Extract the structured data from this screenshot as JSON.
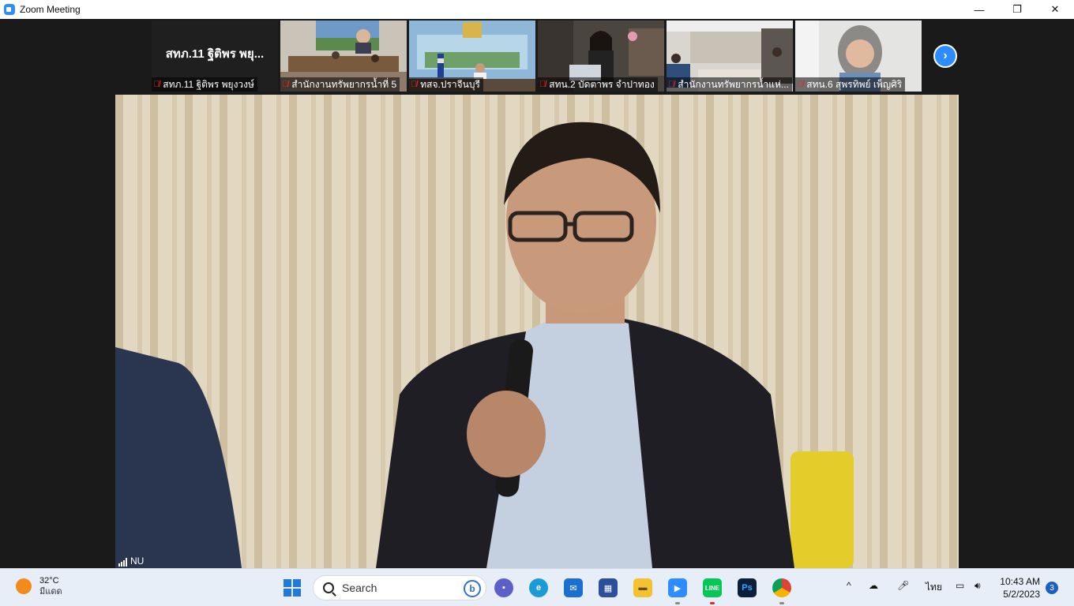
{
  "window": {
    "title": "Zoom Meeting",
    "controls": {
      "minimize": "—",
      "restore": "❐",
      "close": "✕"
    }
  },
  "gallery": {
    "tiles": [
      {
        "big_name": "สทภ.11 ฐิติพร พยุ...",
        "label": "สทภ.11 ฐิติพร พยุงวงษ์"
      },
      {
        "label": "สำนักงานทรัพยากรน้ำที่ 5"
      },
      {
        "label": "ทสจ.ปราจีนบุรี"
      },
      {
        "label": "สทน.2 บัดตาพร จำปาทอง"
      },
      {
        "label": "สำนักงานทรัพยากรน้ำแห่..."
      },
      {
        "label": "สทน.6 สุพรทิพย์ เพ็ญศิริ"
      }
    ],
    "mute_icon": "muted-mic-icon",
    "next_icon": "›"
  },
  "main_video": {
    "network_label": "NU"
  },
  "taskbar": {
    "weather": {
      "temp": "32°C",
      "condition": "มีแดด"
    },
    "search_label": "Search",
    "bing_label": "b",
    "apps": {
      "line_label": "LINE",
      "ps_label": "Ps"
    },
    "tray": {
      "chevron": "^",
      "language": "ไทย"
    },
    "clock": {
      "time": "10:43 AM",
      "date": "5/2/2023"
    },
    "notification_count": "3"
  },
  "colors": {
    "zoom_blue": "#2d8cff",
    "mute_red": "#e02828",
    "taskbar_bg": "#e7eef7"
  }
}
